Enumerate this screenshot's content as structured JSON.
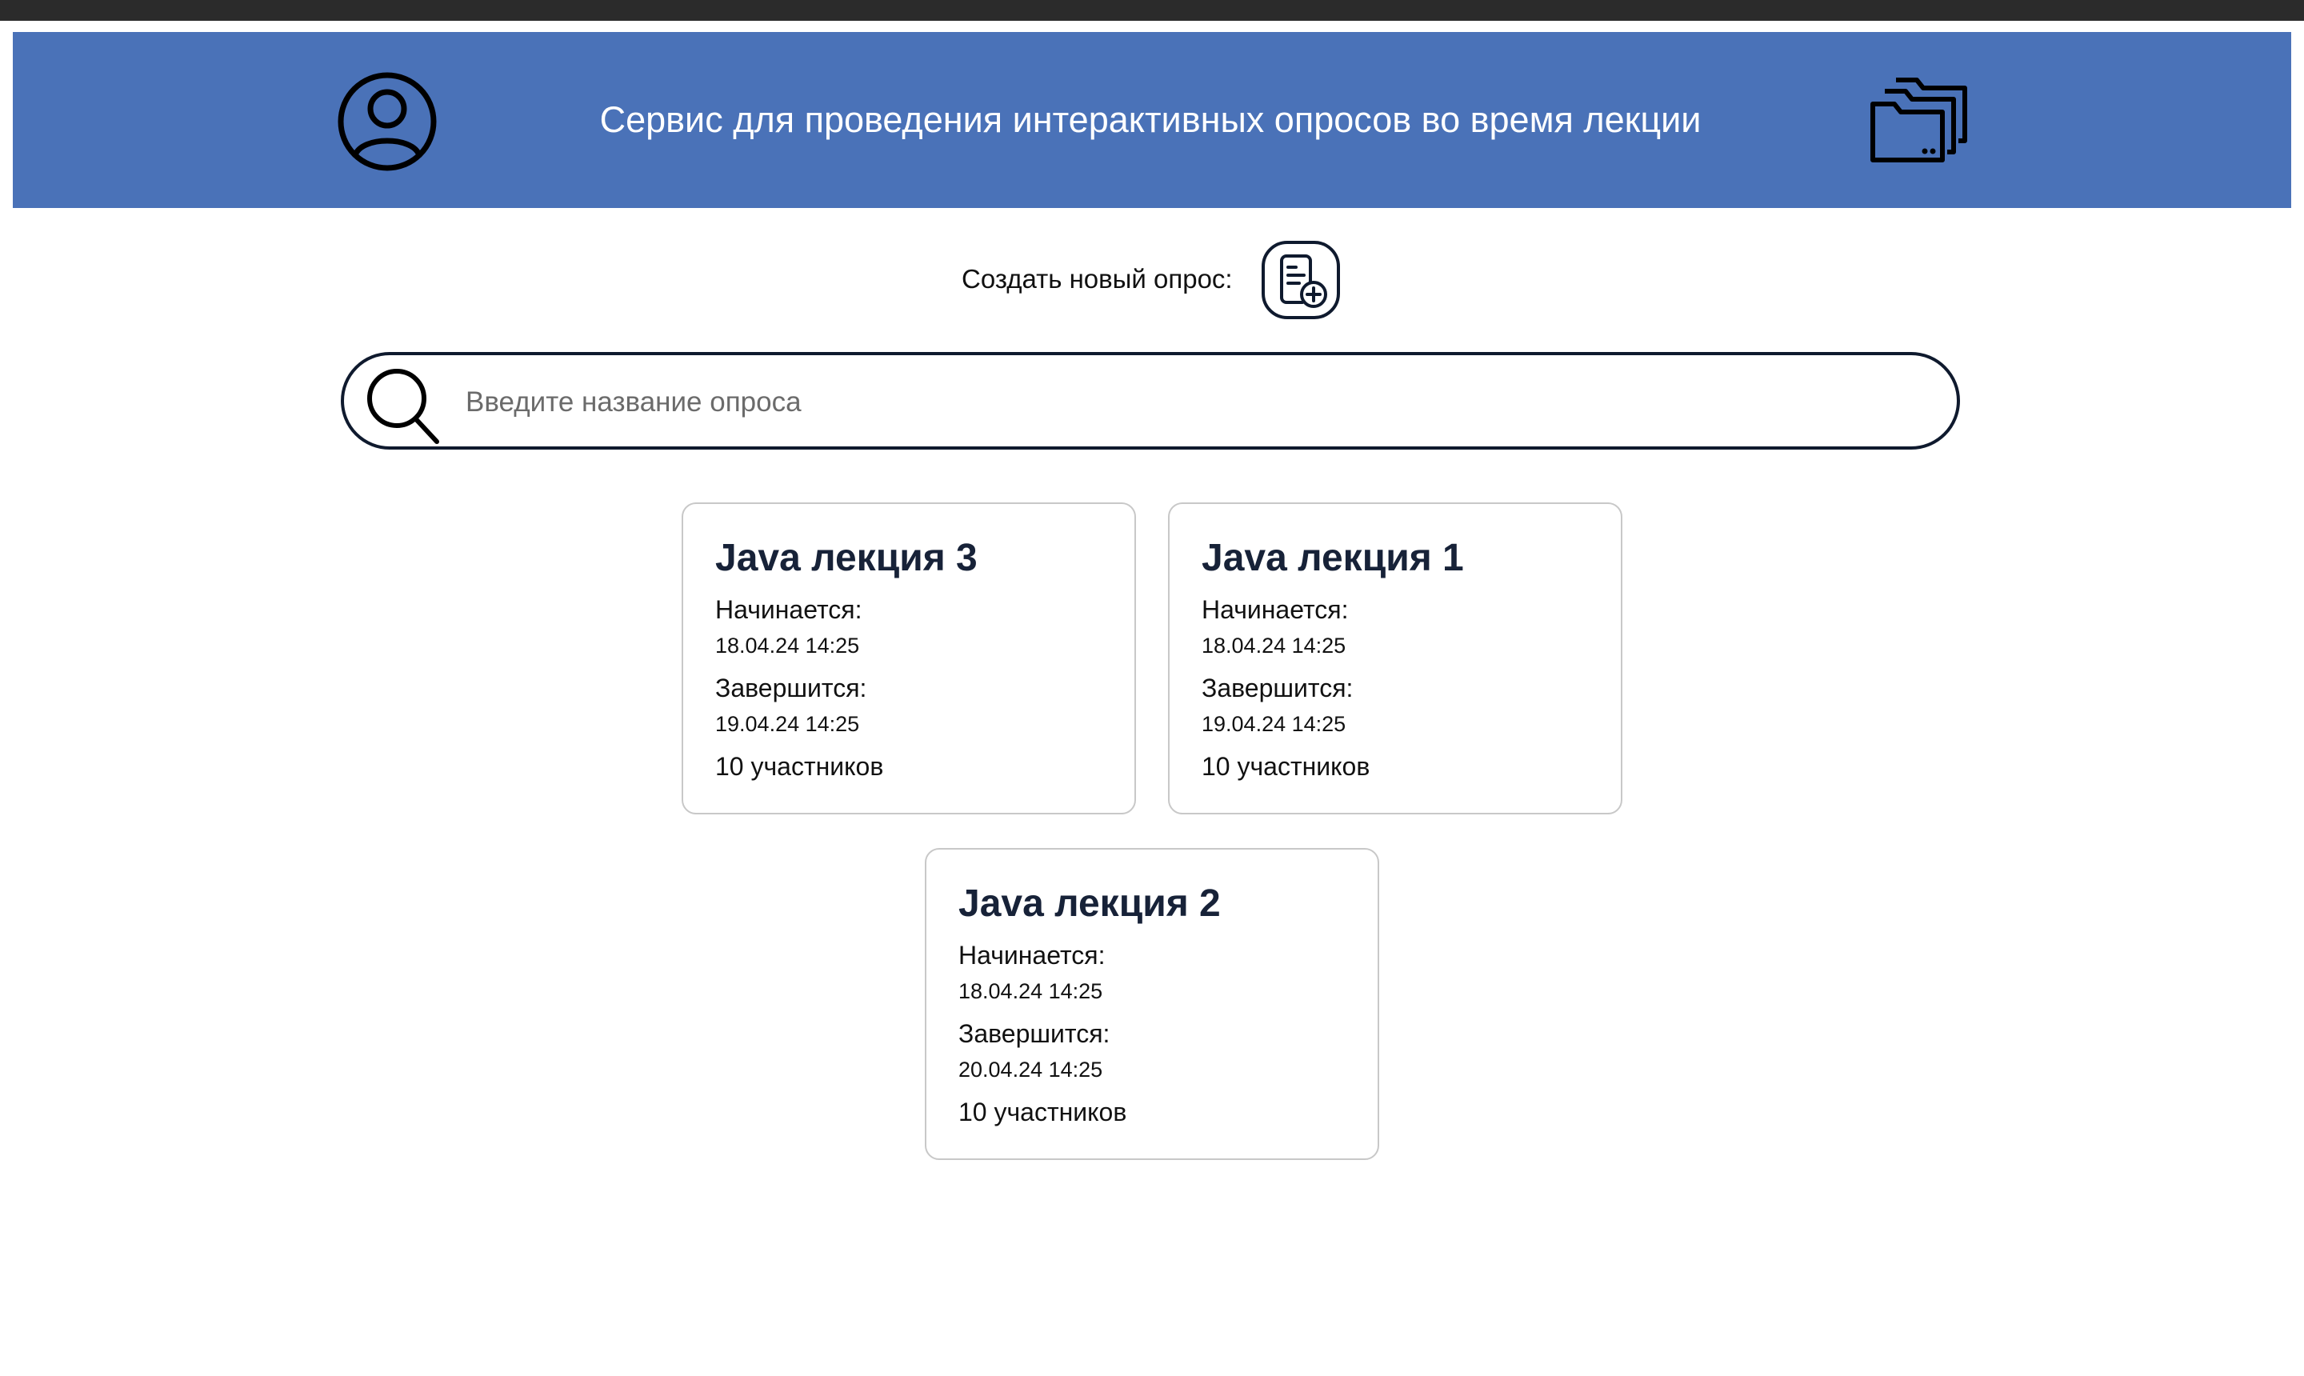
{
  "header": {
    "title": "Сервис для проведения интерактивных опросов во время лекции",
    "bg_color": "#4a72b8",
    "profile_icon": "user-circle-icon",
    "folders_icon": "folders-icon"
  },
  "create": {
    "label": "Создать новый опрос:",
    "icon": "document-add-icon"
  },
  "search": {
    "placeholder": "Введите название опроса",
    "value": "",
    "icon": "search-icon"
  },
  "polls": [
    {
      "title": "Java лекция 3",
      "start_label": "Начинается:",
      "start": "18.04.24 14:25",
      "end_label": "Завершится:",
      "end": "19.04.24 14:25",
      "participants": "10 участников"
    },
    {
      "title": "Java лекция 1",
      "start_label": "Начинается:",
      "start": "18.04.24 14:25",
      "end_label": "Завершится:",
      "end": "19.04.24 14:25",
      "participants": "10 участников"
    },
    {
      "title": "Java лекция 2",
      "start_label": "Начинается:",
      "start": "18.04.24 14:25",
      "end_label": "Завершится:",
      "end": "20.04.24 14:25",
      "participants": "10 участников"
    }
  ]
}
